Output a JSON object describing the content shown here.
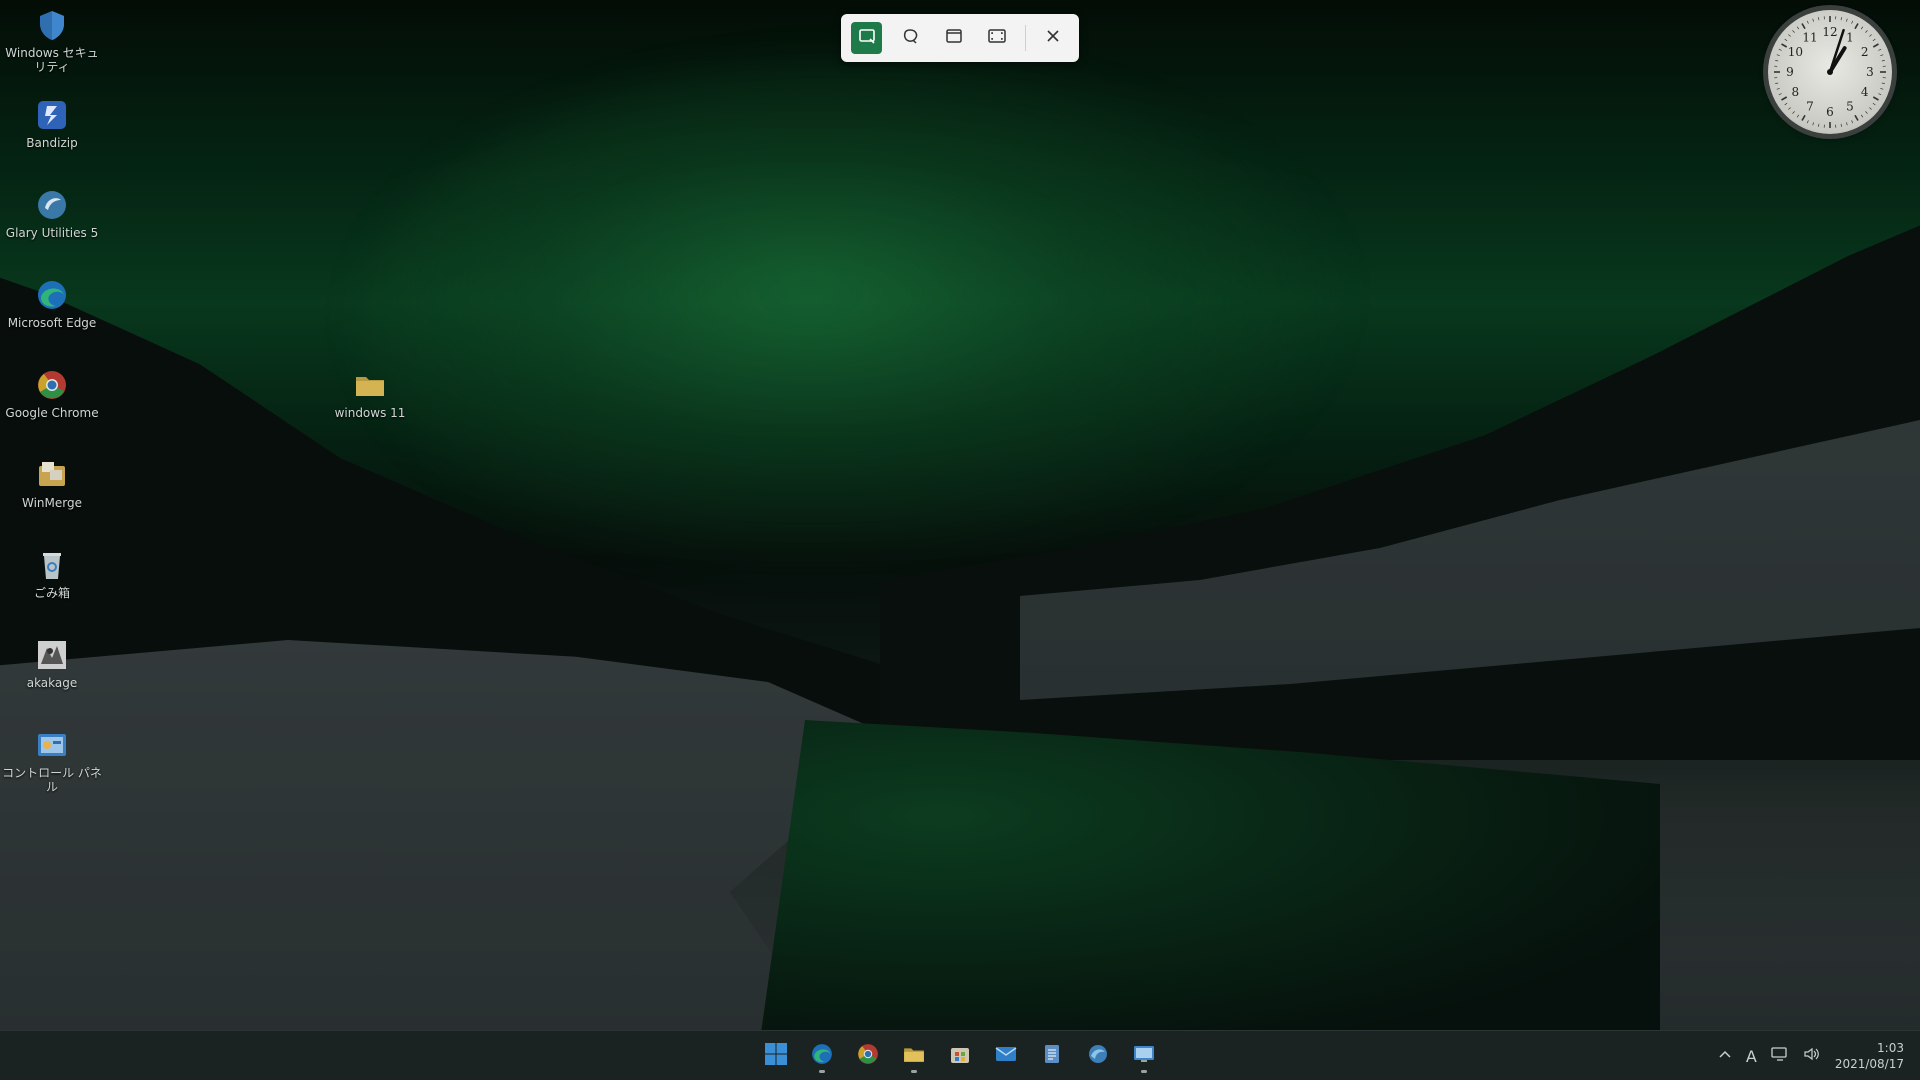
{
  "desktop_icons": [
    {
      "label": "Windows セキュリティ",
      "icon": "windows-security-icon"
    },
    {
      "label": "Bandizip",
      "icon": "bandizip-icon"
    },
    {
      "label": "Glary Utilities 5",
      "icon": "glary-utilities-icon"
    },
    {
      "label": "Microsoft Edge",
      "icon": "edge-icon"
    },
    {
      "label": "Google Chrome",
      "icon": "chrome-icon"
    },
    {
      "label": "WinMerge",
      "icon": "winmerge-icon"
    },
    {
      "label": "ごみ箱",
      "icon": "recycle-bin-icon"
    },
    {
      "label": "akakage",
      "icon": "akakage-icon"
    },
    {
      "label": "コントロール パネル",
      "icon": "control-panel-icon"
    }
  ],
  "folder": {
    "label": "windows 11",
    "icon": "folder-icon"
  },
  "snip_toolbar": {
    "buttons": [
      {
        "name": "rectangle-snip",
        "icon": "rectangle-snip-icon",
        "active": true
      },
      {
        "name": "freeform-snip",
        "icon": "freeform-snip-icon",
        "active": false
      },
      {
        "name": "window-snip",
        "icon": "window-snip-icon",
        "active": false
      },
      {
        "name": "fullscreen-snip",
        "icon": "fullscreen-snip-icon",
        "active": false
      }
    ],
    "close_icon": "close-icon"
  },
  "clock": {
    "numbers": [
      "12",
      "1",
      "2",
      "3",
      "4",
      "5",
      "6",
      "7",
      "8",
      "9",
      "10",
      "11"
    ],
    "hour": 1,
    "minute": 3
  },
  "taskbar": {
    "apps": [
      "start-icon",
      "edge-icon",
      "chrome-icon",
      "file-explorer-icon",
      "store-icon",
      "mail-icon",
      "notepad-icon",
      "browser-icon",
      "remote-desktop-icon"
    ],
    "running": [
      "edge-icon",
      "file-explorer-icon",
      "remote-desktop-icon"
    ],
    "tray": {
      "ime": "A",
      "time": "1:03",
      "date": "2021/08/17"
    }
  },
  "colors": {
    "snip_active": "#1f7a4a",
    "taskbar_bg": "#1b2322"
  }
}
